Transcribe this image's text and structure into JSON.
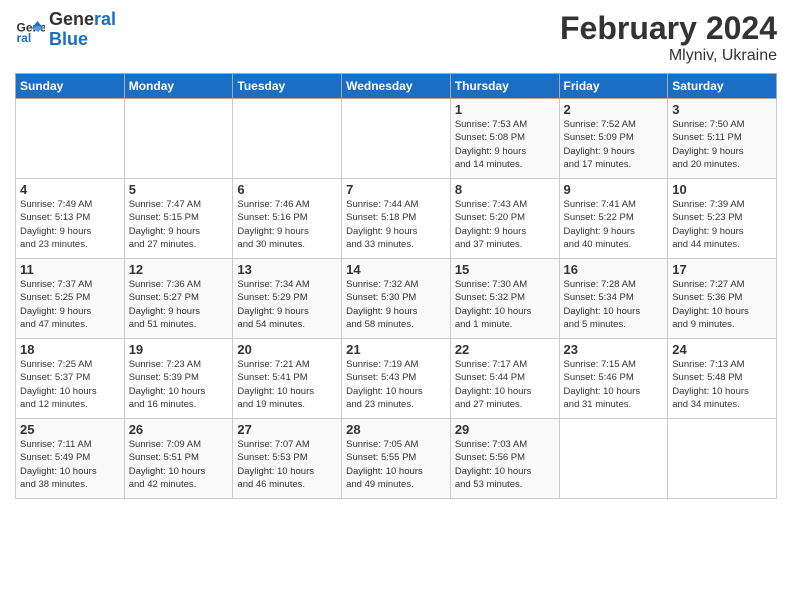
{
  "header": {
    "logo_line1": "General",
    "logo_line2": "Blue",
    "title": "February 2024",
    "subtitle": "Mlyniv, Ukraine"
  },
  "days_of_week": [
    "Sunday",
    "Monday",
    "Tuesday",
    "Wednesday",
    "Thursday",
    "Friday",
    "Saturday"
  ],
  "weeks": [
    [
      {
        "day": "",
        "detail": ""
      },
      {
        "day": "",
        "detail": ""
      },
      {
        "day": "",
        "detail": ""
      },
      {
        "day": "",
        "detail": ""
      },
      {
        "day": "1",
        "detail": "Sunrise: 7:53 AM\nSunset: 5:08 PM\nDaylight: 9 hours\nand 14 minutes."
      },
      {
        "day": "2",
        "detail": "Sunrise: 7:52 AM\nSunset: 5:09 PM\nDaylight: 9 hours\nand 17 minutes."
      },
      {
        "day": "3",
        "detail": "Sunrise: 7:50 AM\nSunset: 5:11 PM\nDaylight: 9 hours\nand 20 minutes."
      }
    ],
    [
      {
        "day": "4",
        "detail": "Sunrise: 7:49 AM\nSunset: 5:13 PM\nDaylight: 9 hours\nand 23 minutes."
      },
      {
        "day": "5",
        "detail": "Sunrise: 7:47 AM\nSunset: 5:15 PM\nDaylight: 9 hours\nand 27 minutes."
      },
      {
        "day": "6",
        "detail": "Sunrise: 7:46 AM\nSunset: 5:16 PM\nDaylight: 9 hours\nand 30 minutes."
      },
      {
        "day": "7",
        "detail": "Sunrise: 7:44 AM\nSunset: 5:18 PM\nDaylight: 9 hours\nand 33 minutes."
      },
      {
        "day": "8",
        "detail": "Sunrise: 7:43 AM\nSunset: 5:20 PM\nDaylight: 9 hours\nand 37 minutes."
      },
      {
        "day": "9",
        "detail": "Sunrise: 7:41 AM\nSunset: 5:22 PM\nDaylight: 9 hours\nand 40 minutes."
      },
      {
        "day": "10",
        "detail": "Sunrise: 7:39 AM\nSunset: 5:23 PM\nDaylight: 9 hours\nand 44 minutes."
      }
    ],
    [
      {
        "day": "11",
        "detail": "Sunrise: 7:37 AM\nSunset: 5:25 PM\nDaylight: 9 hours\nand 47 minutes."
      },
      {
        "day": "12",
        "detail": "Sunrise: 7:36 AM\nSunset: 5:27 PM\nDaylight: 9 hours\nand 51 minutes."
      },
      {
        "day": "13",
        "detail": "Sunrise: 7:34 AM\nSunset: 5:29 PM\nDaylight: 9 hours\nand 54 minutes."
      },
      {
        "day": "14",
        "detail": "Sunrise: 7:32 AM\nSunset: 5:30 PM\nDaylight: 9 hours\nand 58 minutes."
      },
      {
        "day": "15",
        "detail": "Sunrise: 7:30 AM\nSunset: 5:32 PM\nDaylight: 10 hours\nand 1 minute."
      },
      {
        "day": "16",
        "detail": "Sunrise: 7:28 AM\nSunset: 5:34 PM\nDaylight: 10 hours\nand 5 minutes."
      },
      {
        "day": "17",
        "detail": "Sunrise: 7:27 AM\nSunset: 5:36 PM\nDaylight: 10 hours\nand 9 minutes."
      }
    ],
    [
      {
        "day": "18",
        "detail": "Sunrise: 7:25 AM\nSunset: 5:37 PM\nDaylight: 10 hours\nand 12 minutes."
      },
      {
        "day": "19",
        "detail": "Sunrise: 7:23 AM\nSunset: 5:39 PM\nDaylight: 10 hours\nand 16 minutes."
      },
      {
        "day": "20",
        "detail": "Sunrise: 7:21 AM\nSunset: 5:41 PM\nDaylight: 10 hours\nand 19 minutes."
      },
      {
        "day": "21",
        "detail": "Sunrise: 7:19 AM\nSunset: 5:43 PM\nDaylight: 10 hours\nand 23 minutes."
      },
      {
        "day": "22",
        "detail": "Sunrise: 7:17 AM\nSunset: 5:44 PM\nDaylight: 10 hours\nand 27 minutes."
      },
      {
        "day": "23",
        "detail": "Sunrise: 7:15 AM\nSunset: 5:46 PM\nDaylight: 10 hours\nand 31 minutes."
      },
      {
        "day": "24",
        "detail": "Sunrise: 7:13 AM\nSunset: 5:48 PM\nDaylight: 10 hours\nand 34 minutes."
      }
    ],
    [
      {
        "day": "25",
        "detail": "Sunrise: 7:11 AM\nSunset: 5:49 PM\nDaylight: 10 hours\nand 38 minutes."
      },
      {
        "day": "26",
        "detail": "Sunrise: 7:09 AM\nSunset: 5:51 PM\nDaylight: 10 hours\nand 42 minutes."
      },
      {
        "day": "27",
        "detail": "Sunrise: 7:07 AM\nSunset: 5:53 PM\nDaylight: 10 hours\nand 46 minutes."
      },
      {
        "day": "28",
        "detail": "Sunrise: 7:05 AM\nSunset: 5:55 PM\nDaylight: 10 hours\nand 49 minutes."
      },
      {
        "day": "29",
        "detail": "Sunrise: 7:03 AM\nSunset: 5:56 PM\nDaylight: 10 hours\nand 53 minutes."
      },
      {
        "day": "",
        "detail": ""
      },
      {
        "day": "",
        "detail": ""
      }
    ]
  ]
}
